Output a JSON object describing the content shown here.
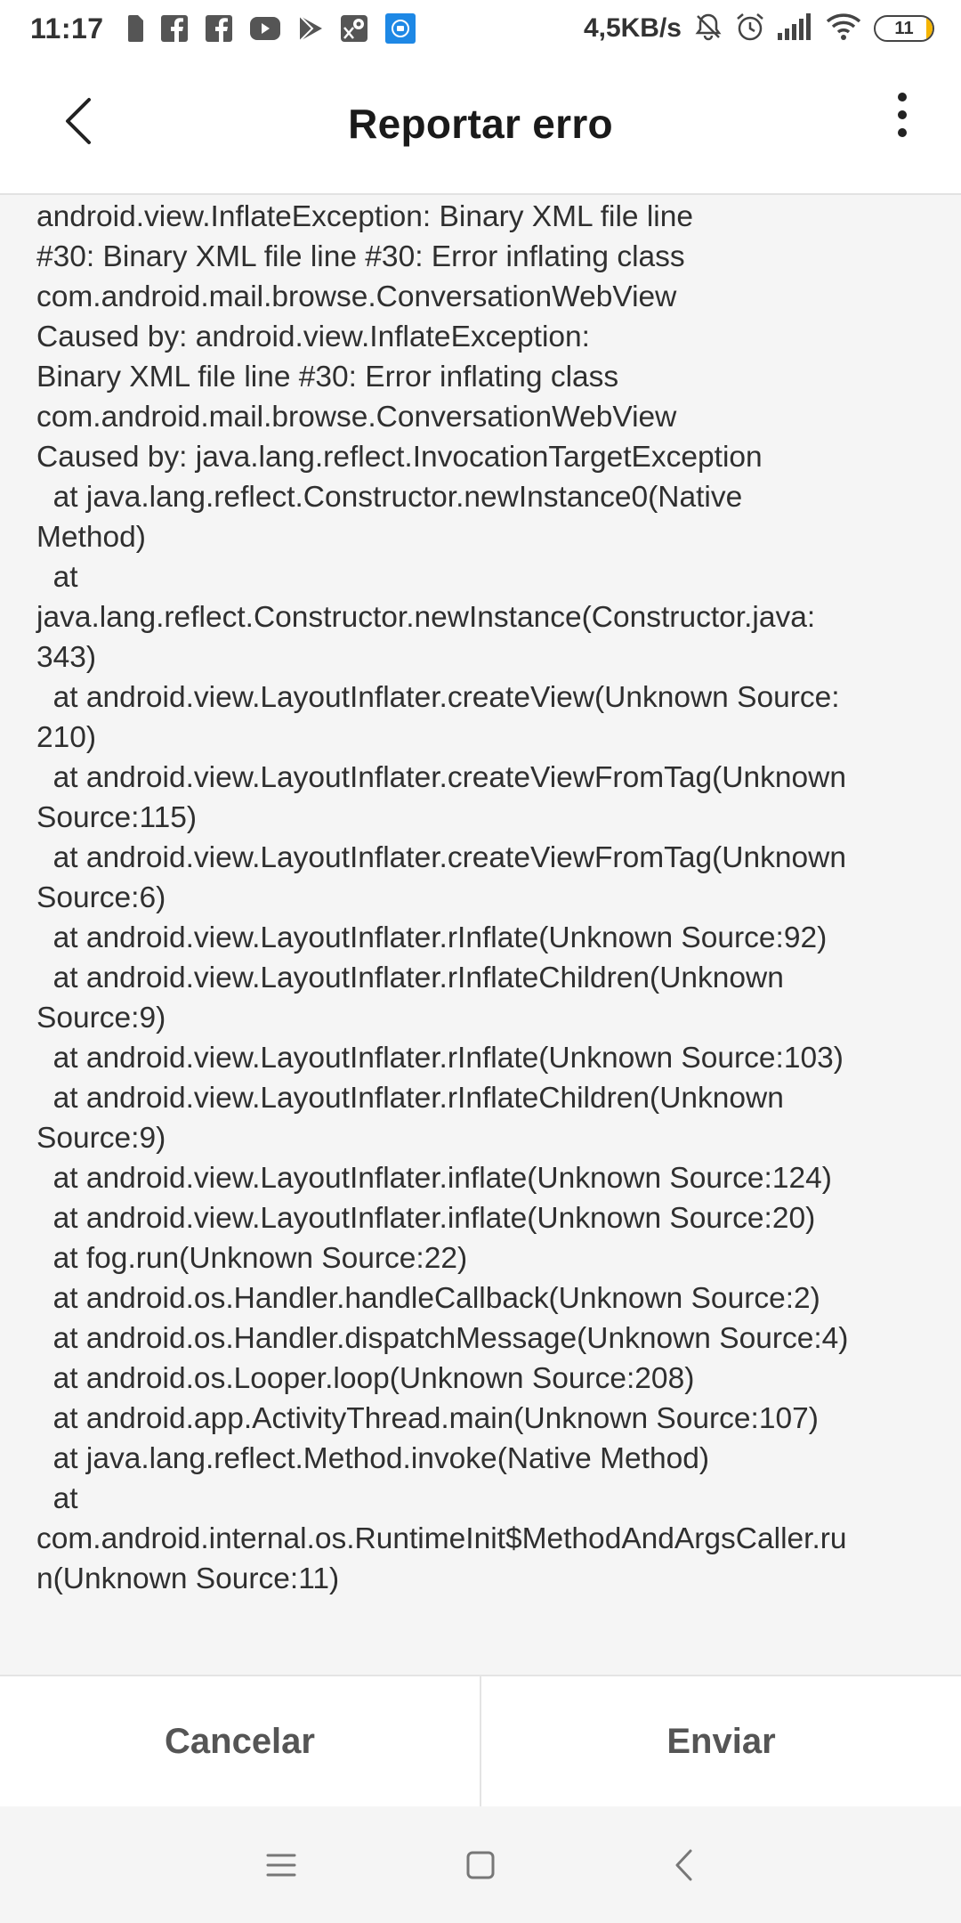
{
  "status_bar": {
    "time": "11:17",
    "network_speed": "4,5KB/s",
    "battery_level": "11",
    "battery_fraction": 0.11,
    "left_icons": [
      "sim-card-icon",
      "facebook-icon",
      "facebook-icon",
      "youtube-icon",
      "play-store-icon",
      "maps-icon",
      "app-notification-icon"
    ],
    "right_icons": [
      "muted-bell-icon",
      "alarm-icon",
      "signal-icon",
      "wifi-icon",
      "battery-icon"
    ],
    "colors": {
      "battery_fill": "#f5b400",
      "app_icon_bg": "#1e88e5"
    }
  },
  "header": {
    "title": "Reportar erro",
    "back_icon": "chevron-left-icon",
    "menu_icon": "more-vert-icon"
  },
  "report": {
    "stack_trace": "android.view.InflateException: Binary XML file line\n#30: Binary XML file line #30: Error inflating class\ncom.android.mail.browse.ConversationWebView\nCaused by: android.view.InflateException:\nBinary XML file line #30: Error inflating class\ncom.android.mail.browse.ConversationWebView\nCaused by: java.lang.reflect.InvocationTargetException\n  at java.lang.reflect.Constructor.newInstance0(Native\nMethod)\n  at\njava.lang.reflect.Constructor.newInstance(Constructor.java:\n343)\n  at android.view.LayoutInflater.createView(Unknown Source:\n210)\n  at android.view.LayoutInflater.createViewFromTag(Unknown\nSource:115)\n  at android.view.LayoutInflater.createViewFromTag(Unknown\nSource:6)\n  at android.view.LayoutInflater.rInflate(Unknown Source:92)\n  at android.view.LayoutInflater.rInflateChildren(Unknown\nSource:9)\n  at android.view.LayoutInflater.rInflate(Unknown Source:103)\n  at android.view.LayoutInflater.rInflateChildren(Unknown\nSource:9)\n  at android.view.LayoutInflater.inflate(Unknown Source:124)\n  at android.view.LayoutInflater.inflate(Unknown Source:20)\n  at fog.run(Unknown Source:22)\n  at android.os.Handler.handleCallback(Unknown Source:2)\n  at android.os.Handler.dispatchMessage(Unknown Source:4)\n  at android.os.Looper.loop(Unknown Source:208)\n  at android.app.ActivityThread.main(Unknown Source:107)\n  at java.lang.reflect.Method.invoke(Native Method)\n  at\ncom.android.internal.os.RuntimeInit$MethodAndArgsCaller.ru\nn(Unknown Source:11)"
  },
  "actions": {
    "cancel_label": "Cancelar",
    "send_label": "Enviar"
  },
  "nav_bar": {
    "icons": [
      "menu-icon",
      "home-icon",
      "back-icon"
    ]
  }
}
